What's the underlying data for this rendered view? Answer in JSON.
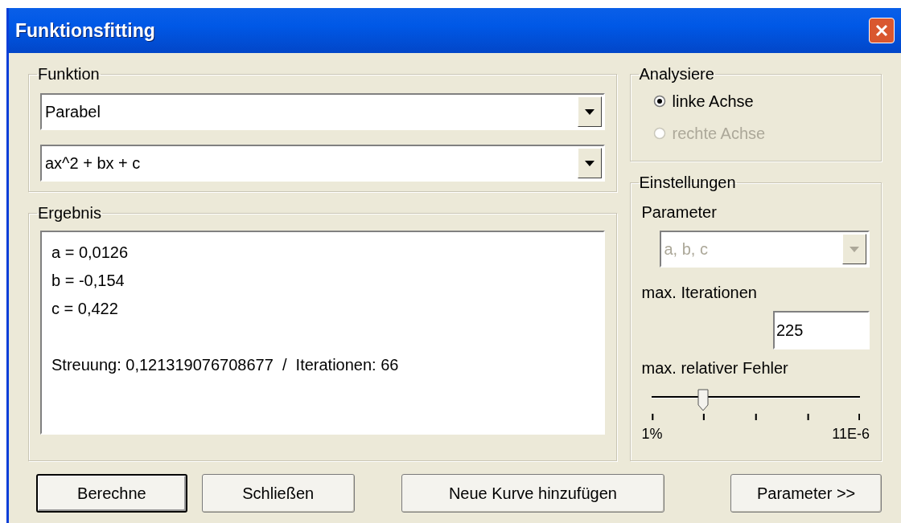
{
  "window": {
    "title": "Funktionsfitting"
  },
  "funktion": {
    "legend": "Funktion",
    "type_combo": {
      "value": "Parabel"
    },
    "formula_combo": {
      "value": "ax^2 + bx + c"
    }
  },
  "ergebnis": {
    "legend": "Ergebnis",
    "lines": [
      "a = 0,0126",
      "b = -0,154",
      "c = 0,422"
    ],
    "summary": "Streuung: 0,121319076708677  /  Iterationen: 66"
  },
  "analysiere": {
    "legend": "Analysiere",
    "options": [
      {
        "label": "linke Achse",
        "selected": true,
        "disabled": false
      },
      {
        "label": "rechte Achse",
        "selected": false,
        "disabled": true
      }
    ]
  },
  "einstellungen": {
    "legend": "Einstellungen",
    "parameter_label": "Parameter",
    "parameter_combo": {
      "value": "a, b, c",
      "disabled": true
    },
    "iterations_label": "max. Iterationen",
    "iterations_value": "225",
    "error_label": "max. relativer Fehler",
    "error_slider": {
      "level": 0.25,
      "min_label": "1%",
      "max_label": "11E-6"
    }
  },
  "buttons": [
    {
      "label": "Berechne",
      "default": true
    },
    {
      "label": "Schließen",
      "default": false
    },
    {
      "label": "Neue Kurve hinzufügen",
      "default": false
    },
    {
      "label": "Parameter >>",
      "default": false
    }
  ]
}
